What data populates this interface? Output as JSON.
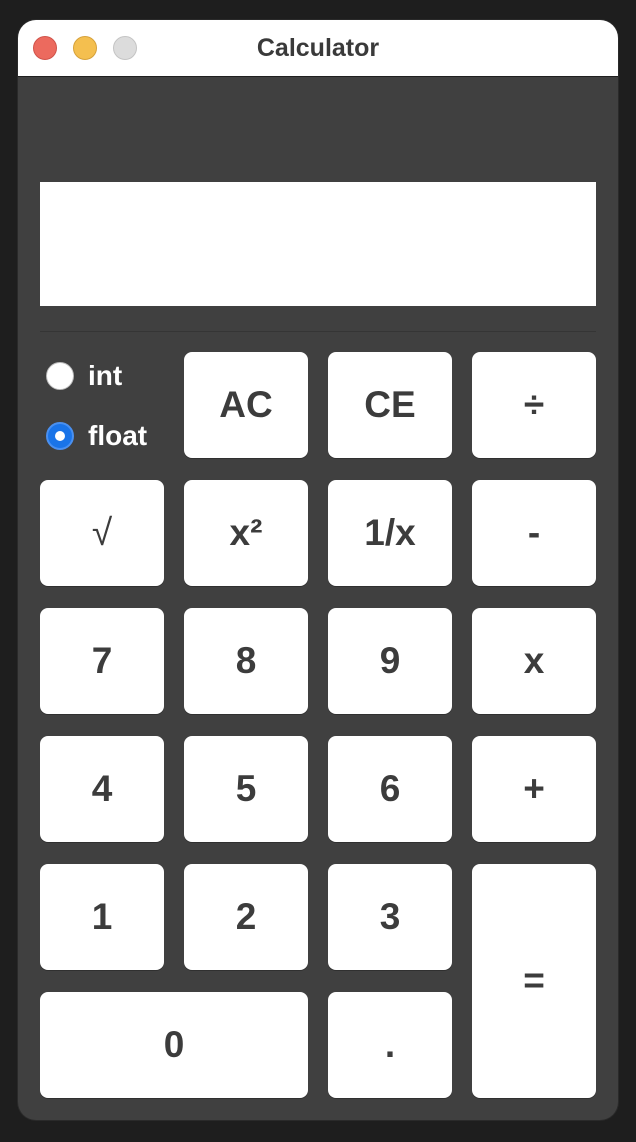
{
  "window": {
    "title": "Calculator"
  },
  "display": {
    "value": ""
  },
  "mode": {
    "options": [
      {
        "label": "int",
        "selected": false
      },
      {
        "label": "float",
        "selected": true
      }
    ]
  },
  "keypad": {
    "ac": "AC",
    "ce": "CE",
    "divide": "÷",
    "sqrt": "√",
    "square": "x²",
    "reciprocal": "1/x",
    "subtract": "-",
    "seven": "7",
    "eight": "8",
    "nine": "9",
    "multiply": "x",
    "four": "4",
    "five": "5",
    "six": "6",
    "add": "+",
    "one": "1",
    "two": "2",
    "three": "3",
    "equals": "=",
    "zero": "0",
    "decimal": "."
  },
  "colors": {
    "window_bg": "#404040",
    "button_bg": "#ffffff",
    "button_text": "#3c3c3c",
    "radio_selected": "#1a74e8",
    "close": "#ec6a5e",
    "minimize": "#f4bf4f",
    "maximize_disabled": "#dcdcdc"
  }
}
